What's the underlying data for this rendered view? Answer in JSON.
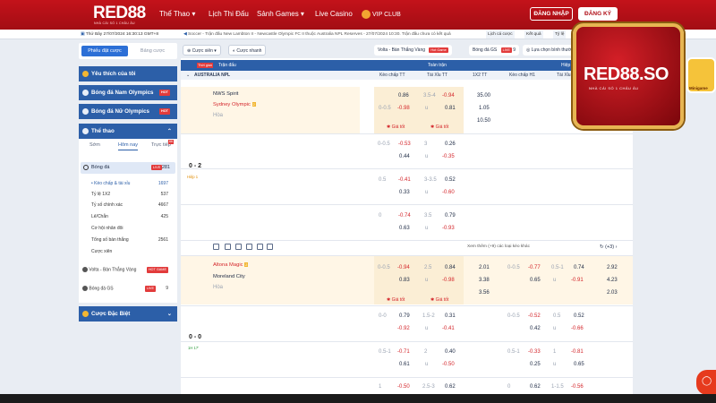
{
  "header": {
    "logo": "RED88",
    "logo_tagline": "NHÀ CÁI SỐ 1 CHÂU ÂU",
    "nav": [
      "Thể Thao",
      "Lịch Thi Đấu",
      "Sảnh Games",
      "Live Casino",
      "VIP CLUB"
    ],
    "login": "ĐĂNG NHẬP",
    "register": "ĐĂNG KÝ"
  },
  "infobar": {
    "datetime": "Thứ Bảy 27/07/2024 16:30:13 GMT+8",
    "ticker": "Soccer - Trận đấu New Lambton II - Newcastle Olympic FC II thuộc Australia NPL Reserves - 27/07/2024 10:30. Trận đấu chưa có kết quả",
    "btn1": "Lịch cá cược",
    "btn2": "Kết quả",
    "btn3": "Tỷ lệ"
  },
  "sidebar": {
    "toggle_on": "Phiếu đặt cược",
    "toggle_off": "Bảng cược",
    "items": [
      {
        "label": "Yêu thích của tôi"
      },
      {
        "label": "Bóng đá Nam Olympics",
        "badge": "HOT"
      },
      {
        "label": "Bóng đá Nữ Olympics",
        "badge": "HOT"
      },
      {
        "label": "Thể thao"
      }
    ],
    "tabs": [
      "Sớm",
      "Hôm nay",
      "Trực tiếp"
    ],
    "tab_count": "66",
    "sport": {
      "label": "Bóng đá",
      "badge": "LIVE",
      "count": "281"
    },
    "subs": [
      {
        "label": "Kèo chấp & tài xỉu",
        "count": "1697"
      },
      {
        "label": "Tỷ lệ 1X2",
        "count": "537"
      },
      {
        "label": "Tỷ số chính xác",
        "count": "4667"
      },
      {
        "label": "Lẻ/Chẵn",
        "count": "425"
      },
      {
        "label": "Cơ hội nhân đôi",
        "count": ""
      },
      {
        "label": "Tổng số bàn thắng",
        "count": "2561"
      },
      {
        "label": "Cược xiên",
        "count": ""
      }
    ],
    "extra": [
      {
        "label": "Volta - Bàn Thắng Vàng",
        "badge": "HOT GAME"
      },
      {
        "label": "Bóng đá GS",
        "badge": "LIVE",
        "count": "9"
      }
    ],
    "special": "Cược Đặc Biệt"
  },
  "controls": {
    "bet_type": "Cược xiên",
    "toggle": "Cược nhanh",
    "volta": "Volta - Bàn Thắng Vàng",
    "volta_badge": "Hot Game",
    "gs": "Bóng đá GS",
    "gs_count": "9",
    "choose": "Lựa chọn bình thường"
  },
  "table": {
    "col_time": "Thời gian",
    "col_match": "Trận đấu",
    "col_fulltime": "Toàn trận",
    "col_half": "Hiệp 1",
    "league": "AUSTRALIA NPL",
    "cols": [
      "Kèo chấp TT",
      "Tài Xỉu TT",
      "1X2 TT",
      "Kèo chấp H1",
      "Tài Xỉu"
    ],
    "more_link": "Xem thêm (+9) các loại kèo khác",
    "more_count": "(+3)",
    "match1": {
      "home": "NWS Spirit",
      "away": "Sydney Olympic",
      "away_card": "2",
      "draw": "Hòa",
      "score": "0 - 2",
      "status": "Hiệp 1",
      "lines": [
        {
          "h_line": "",
          "h_home": "0.86",
          "h_line2": "0-0.5",
          "h_away": "-0.98",
          "ou_line": "3.5-4",
          "ou_over": "-0.94",
          "ou_u": "u",
          "ou_under": "0.81",
          "x": [
            "35.00",
            "1.05",
            "10.50"
          ]
        },
        {
          "h_line": "0-0.5",
          "h_home": "-0.53",
          "h_away": "0.44",
          "ou_line": "3",
          "ou_over": "0.26",
          "ou_u": "u",
          "ou_under": "-0.35"
        },
        {
          "h_line": "0.5",
          "h_home": "-0.41",
          "h_away": "0.33",
          "ou_line": "3-3.5",
          "ou_over": "0.52",
          "ou_u": "u",
          "ou_under": "-0.60"
        },
        {
          "h_line": "0",
          "h_home": "-0.74",
          "h_away": "0.63",
          "ou_line": "3.5",
          "ou_over": "0.79",
          "ou_u": "u",
          "ou_under": "-0.93"
        }
      ],
      "tip": "Giá tốt"
    },
    "match2": {
      "home": "Altona Magic",
      "home_card": "2",
      "away": "Moreland City",
      "draw": "Hòa",
      "score": "0 - 0",
      "status": "1H 17'",
      "lines": [
        {
          "h_line": "0-0.5",
          "h_home": "-0.94",
          "h_away": "0.83",
          "ou_line": "2.5",
          "ou_over": "0.84",
          "ou_u": "u",
          "ou_under": "-0.98",
          "x": [
            "2.01",
            "3.38",
            "3.56"
          ],
          "h1_line": "0-0.5",
          "h1_home": "-0.77",
          "h1_away": "0.65",
          "h1_ou_line": "0.5-1",
          "h1_over": "0.74",
          "h1_u": "u",
          "h1_under": "-0.91",
          "h1x": [
            "2.92",
            "4.23",
            "2.03"
          ]
        },
        {
          "h_line": "0-0",
          "h_home": "0.79",
          "h_away": "-0.92",
          "ou_line": "1.5-2",
          "ou_over": "0.31",
          "ou_u": "u",
          "ou_under": "-0.41",
          "h1_line": "0-0.5",
          "h1_home": "-0.52",
          "h1_away": "0.42",
          "h1_ou_line": "0.5",
          "h1_over": "0.52",
          "h1_u": "u",
          "h1_under": "-0.66"
        },
        {
          "h_line": "0.5-1",
          "h_home": "-0.71",
          "h_away": "0.61",
          "ou_line": "2",
          "ou_over": "0.40",
          "ou_u": "u",
          "ou_under": "-0.50",
          "h1_line": "0.5-1",
          "h1_home": "-0.33",
          "h1_away": "0.25",
          "h1_ou_line": "1",
          "h1_over": "-0.81",
          "h1_u": "u",
          "h1_under": "0.65"
        },
        {
          "h_line": "1",
          "h_home": "-0.50",
          "h_away": "",
          "ou_line": "2.5-3",
          "ou_over": "0.62",
          "h1_line": "0",
          "h1_home": "0.62",
          "h1_ou_line": "1-1.5",
          "h1_over": "-0.56"
        }
      ]
    }
  },
  "promo": {
    "brand": "RED88.SO",
    "tagline": "NHÀ CÁI SỐ 1 CHÂU ÂU",
    "mini": "Minigame"
  },
  "colors": {
    "brand_red": "#c4121a",
    "nav_blue": "#2c5fa8",
    "highlight": "#fbeed5",
    "negative": "#d4262b"
  }
}
